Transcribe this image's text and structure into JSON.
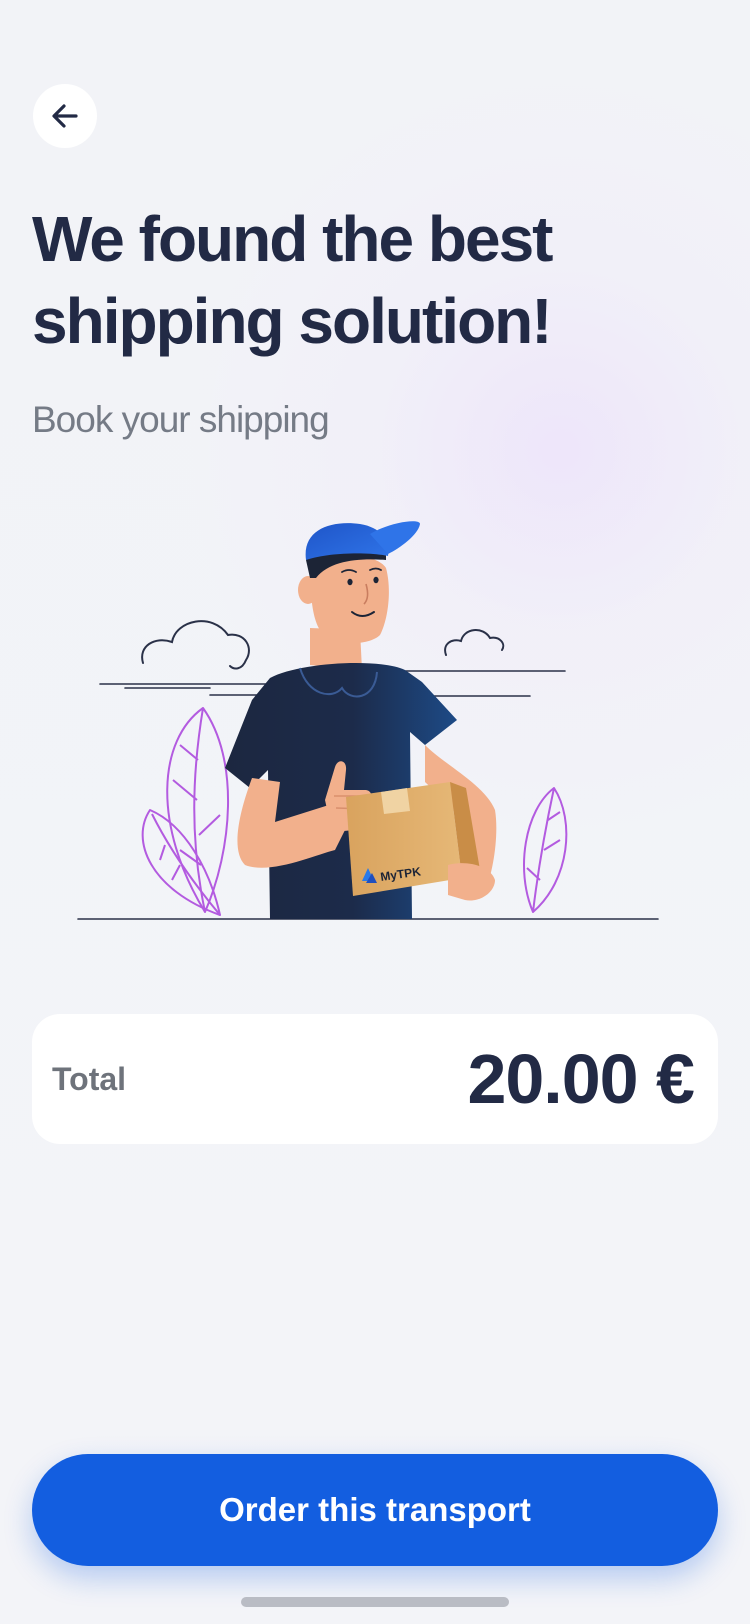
{
  "header": {
    "back_icon": "arrow-left-icon",
    "title": "We found the best shipping solution!",
    "subtitle": "Book your shipping"
  },
  "illustration": {
    "description_icon": "delivery-man-illustration",
    "box_brand": "MyTPK"
  },
  "summary": {
    "total_label": "Total",
    "total_amount": "20.00 €"
  },
  "actions": {
    "order_label": "Order this transport"
  },
  "colors": {
    "primary": "#135ee0",
    "text_dark": "#222a45",
    "text_muted": "#757b86",
    "background": "#f3f4f8",
    "accent_leaves": "#b35be0"
  }
}
